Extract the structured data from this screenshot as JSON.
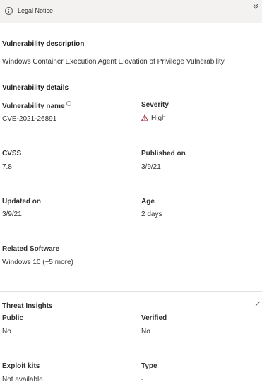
{
  "legal_notice": {
    "label": "Legal Notice"
  },
  "vulnerability_description": {
    "heading": "Vulnerability description",
    "text": "Windows Container Execution Agent Elevation of Privilege Vulnerability"
  },
  "vulnerability_details": {
    "heading": "Vulnerability details",
    "name_label": "Vulnerability name",
    "name_value": "CVE-2021-26891",
    "severity_label": "Severity",
    "severity_value": "High",
    "cvss_label": "CVSS",
    "cvss_value": "7.8",
    "published_label": "Published on",
    "published_value": "3/9/21",
    "updated_label": "Updated on",
    "updated_value": "3/9/21",
    "age_label": "Age",
    "age_value": "2 days",
    "software_label": "Related Software",
    "software_value": "Windows 10 (+5 more)"
  },
  "threat_insights": {
    "heading": "Threat Insights",
    "public_label": "Public",
    "public_value": "No",
    "verified_label": "Verified",
    "verified_value": "No",
    "exploit_kits_label": "Exploit kits",
    "exploit_kits_value": "Not available",
    "type_label": "Type",
    "type_value": "-"
  },
  "icons": {
    "notice": "info-circle-icon",
    "collapse": "double-chevron-down-icon",
    "info": "info-icon",
    "warning": "warning-triangle-icon",
    "edit": "pencil-icon"
  },
  "colors": {
    "warning": "#a4262c",
    "notice_bar": "#f3f2f1"
  }
}
